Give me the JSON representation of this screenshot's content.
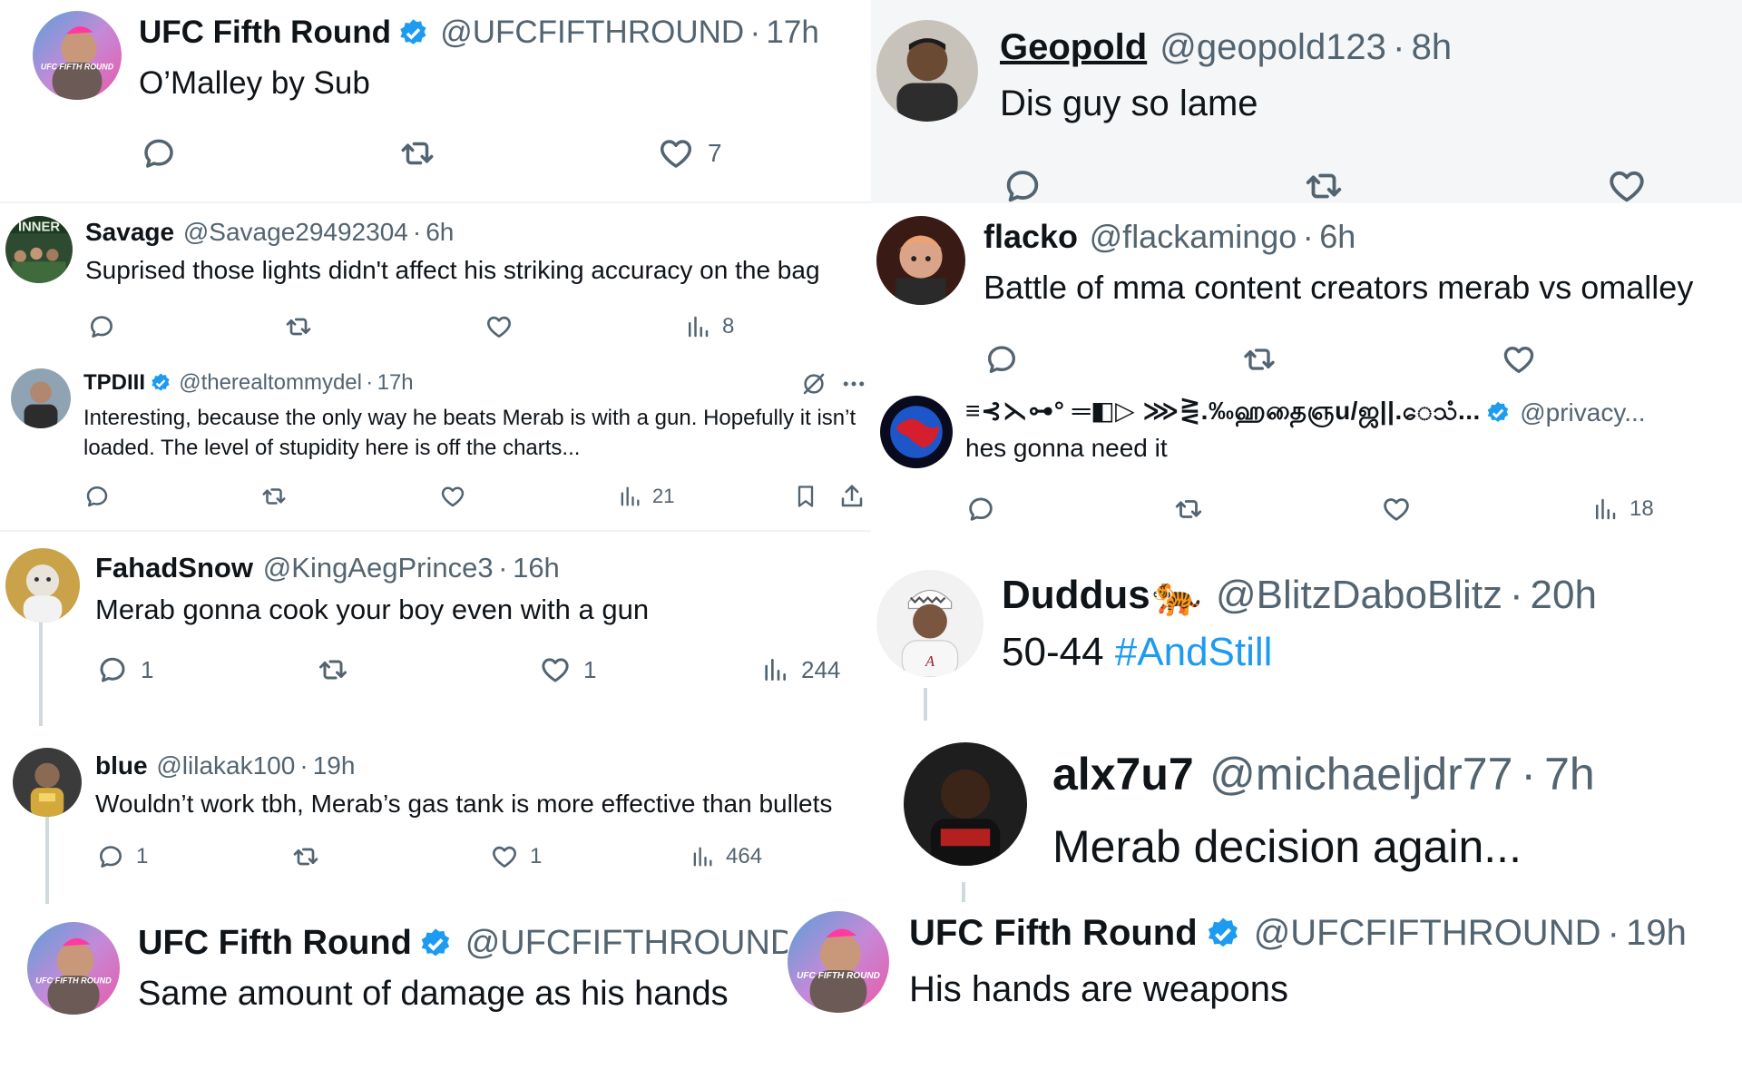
{
  "tweets": [
    {
      "id": "t1",
      "name": "UFC Fifth Round",
      "verified": true,
      "handle": "@UFCFIFTHROUND",
      "time": "17h",
      "text": "O’Malley by Sub",
      "replies": "",
      "retweets": "",
      "likes": "7",
      "views": ""
    },
    {
      "id": "t2",
      "name": "Savage",
      "verified": false,
      "handle": "@Savage29492304",
      "time": "6h",
      "text": "Suprised those lights didn't affect his striking accuracy on the bag",
      "replies": "",
      "retweets": "",
      "likes": "",
      "views": "8",
      "avatar_text": "INNER"
    },
    {
      "id": "t3",
      "name": "TPDIII",
      "verified": true,
      "handle": "@therealtommydel",
      "time": "17h",
      "text": "Interesting, because the only way he beats Merab is with a gun.  Hopefully it isn’t loaded.  The level of stupidity here is off the charts...",
      "replies": "",
      "retweets": "",
      "likes": "",
      "views": "21"
    },
    {
      "id": "t4",
      "name": "FahadSnow",
      "verified": false,
      "handle": "@KingAegPrince3",
      "time": "16h",
      "text": "Merab gonna cook your boy even with a gun",
      "replies": "1",
      "retweets": "",
      "likes": "1",
      "views": "244"
    },
    {
      "id": "t5",
      "name": "blue",
      "verified": false,
      "handle": "@lilakak100",
      "time": "19h",
      "text": "Wouldn’t work tbh, Merab’s gas tank is more effective than bullets",
      "replies": "1",
      "retweets": "",
      "likes": "1",
      "views": "464"
    },
    {
      "id": "t6",
      "name": "UFC Fifth Round",
      "verified": true,
      "handle": "@UFCFIFTHROUND",
      "time": "",
      "text": "Same amount of damage as his hands"
    },
    {
      "id": "t7",
      "name": "Geopold",
      "verified": false,
      "handle": "@geopold123",
      "time": "8h",
      "text": "Dis guy so lame"
    },
    {
      "id": "t8",
      "name": "flacko",
      "verified": false,
      "handle": "@flackamingo",
      "time": "6h",
      "text": "Battle of mma content creators merab vs omalley"
    },
    {
      "id": "t9",
      "name": "≡⊰⋋⊶°  ═◧▷ ⋙⋛.‰ஹதைஞu/ஜ||.ေသံ...",
      "verified": true,
      "handle": "@privacy...",
      "time": "",
      "text": "hes gonna need it",
      "views": "18"
    },
    {
      "id": "t10",
      "name": "Duddus",
      "emoji": "🐅",
      "verified": false,
      "handle": "@BlitzDaboBlitz",
      "time": "20h",
      "text_plain": "50-44",
      "hashtag": "#AndStill"
    },
    {
      "id": "t11",
      "name": "alx7u7",
      "verified": false,
      "handle": "@michaeljdr77",
      "time": "7h",
      "text": "Merab decision again..."
    },
    {
      "id": "t12",
      "name": "UFC Fifth Round",
      "verified": true,
      "handle": "@UFCFIFTHROUND",
      "time": "19h",
      "text": "His hands are weapons"
    }
  ],
  "avatar_logo_text": "UFC FIFTH ROUND",
  "sep": "·",
  "colors": {
    "verified": "#1d9bf0",
    "hashtag": "#1d9bf0",
    "muted": "#536471"
  },
  "icons": [
    "reply-icon",
    "retweet-icon",
    "like-icon",
    "views-icon",
    "bookmark-icon",
    "share-icon",
    "grok-icon",
    "more-icon",
    "verified-badge-icon"
  ]
}
